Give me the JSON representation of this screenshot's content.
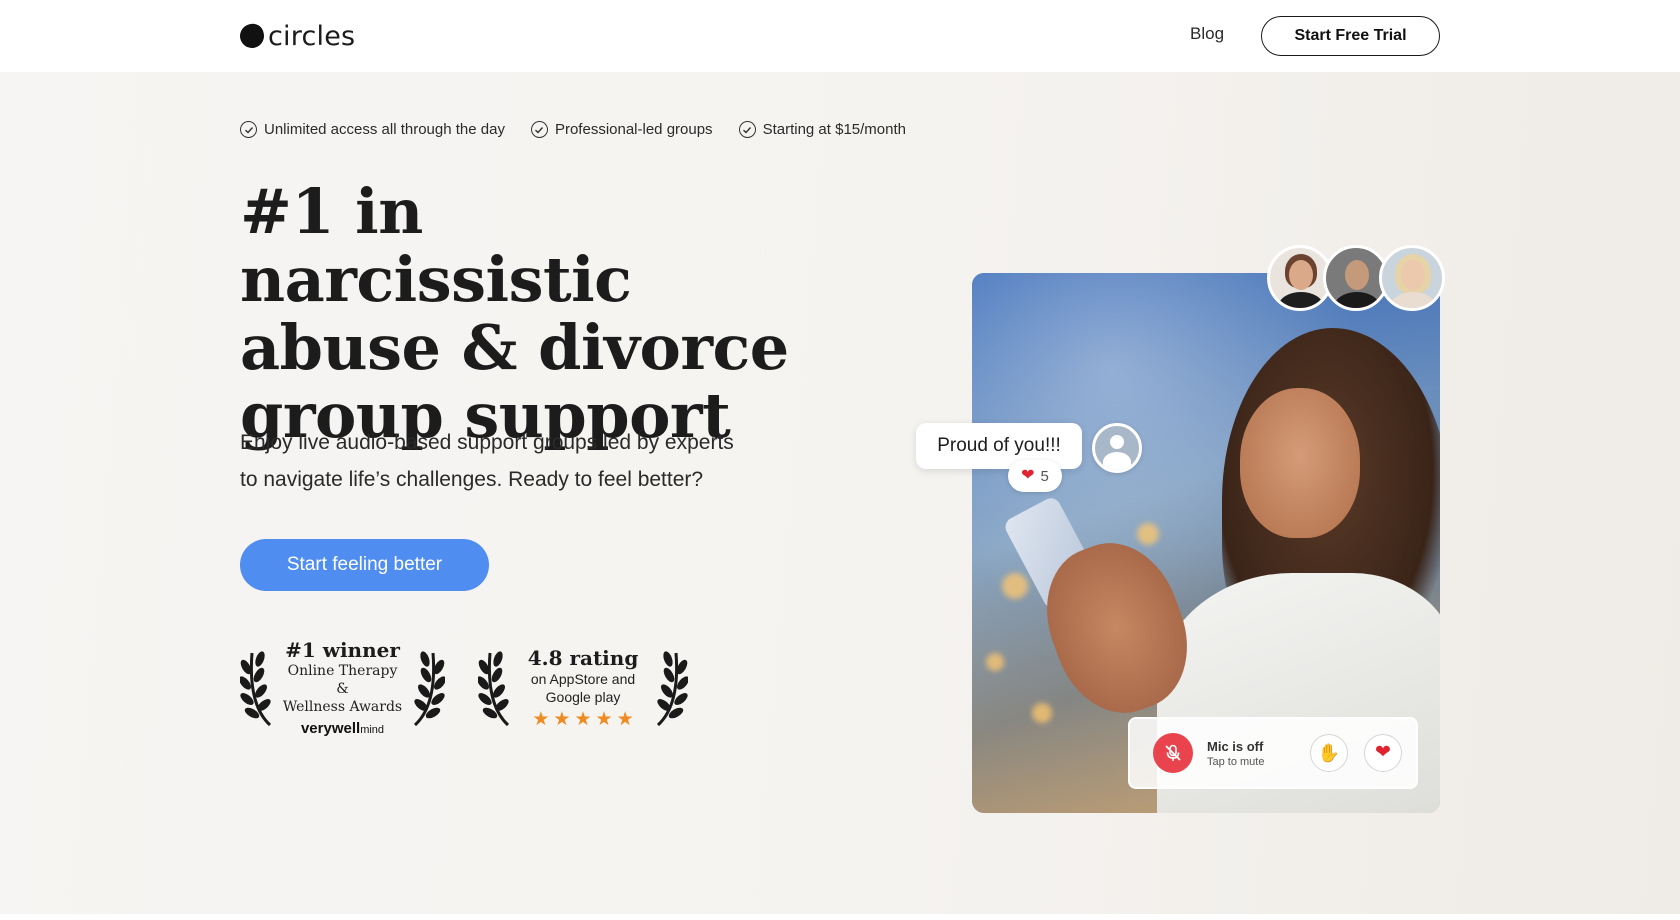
{
  "header": {
    "logo_text": "circles",
    "nav_blog": "Blog",
    "trial_button": "Start Free Trial"
  },
  "hero": {
    "features": [
      "Unlimited access all through the day",
      "Professional-led groups",
      "Starting at $15/month"
    ],
    "headline_lines": [
      "#1 in narcissistic",
      "abuse & divorce",
      "group support"
    ],
    "subtext_lines": [
      "Enjoy live audio-based support groups led by experts",
      "to navigate life’s challenges. Ready to feel better?"
    ],
    "cta_button": "Start feeling better",
    "awards": [
      {
        "title": "#1 winner",
        "lines": [
          "Online Therapy &",
          "Wellness Awards"
        ],
        "brand": "verywell",
        "brand_sub": "mind"
      },
      {
        "title": "4.8 rating",
        "lines": [
          "on AppStore and",
          "Google play"
        ],
        "stars": 5
      }
    ]
  },
  "illustration": {
    "bubble_text": "Proud of you!!!",
    "reaction_count": "5",
    "mic": {
      "title": "Mic is off",
      "subtitle": "Tap to mute"
    }
  },
  "colors": {
    "cta": "#4f8df0",
    "star": "#f08b21",
    "mic_off": "#e9434d",
    "heart": "#e0242f"
  }
}
